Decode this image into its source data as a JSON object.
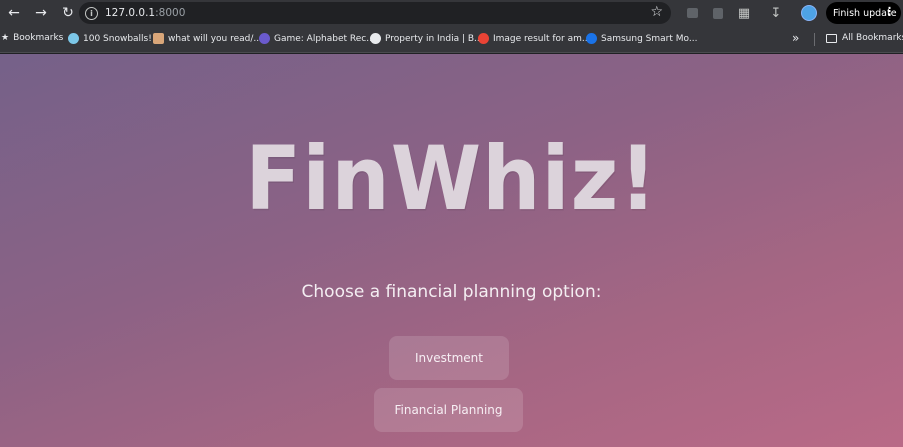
{
  "browser": {
    "url_host": "127.0.0.1",
    "url_port": ":8000",
    "update_button": "Finish update"
  },
  "bookmarks": {
    "label": "Bookmarks",
    "items": [
      {
        "label": "100 Snowballs!",
        "color": "#7cc7e8"
      },
      {
        "label": "what will you read/...",
        "color": "#d9a679"
      },
      {
        "label": "Game: Alphabet Rec...",
        "color": "#6a5acd"
      },
      {
        "label": "Property in India | B...",
        "color": "#e8eaed"
      },
      {
        "label": "Image result for am...",
        "color": "#ea4335"
      },
      {
        "label": "Samsung Smart Mo...",
        "color": "#1a73e8"
      }
    ],
    "all_bookmarks": "All Bookmarks"
  },
  "app": {
    "logo": "FinWhiz!",
    "prompt": "Choose a financial planning option:",
    "options": [
      "Investment",
      "Financial Planning"
    ]
  }
}
